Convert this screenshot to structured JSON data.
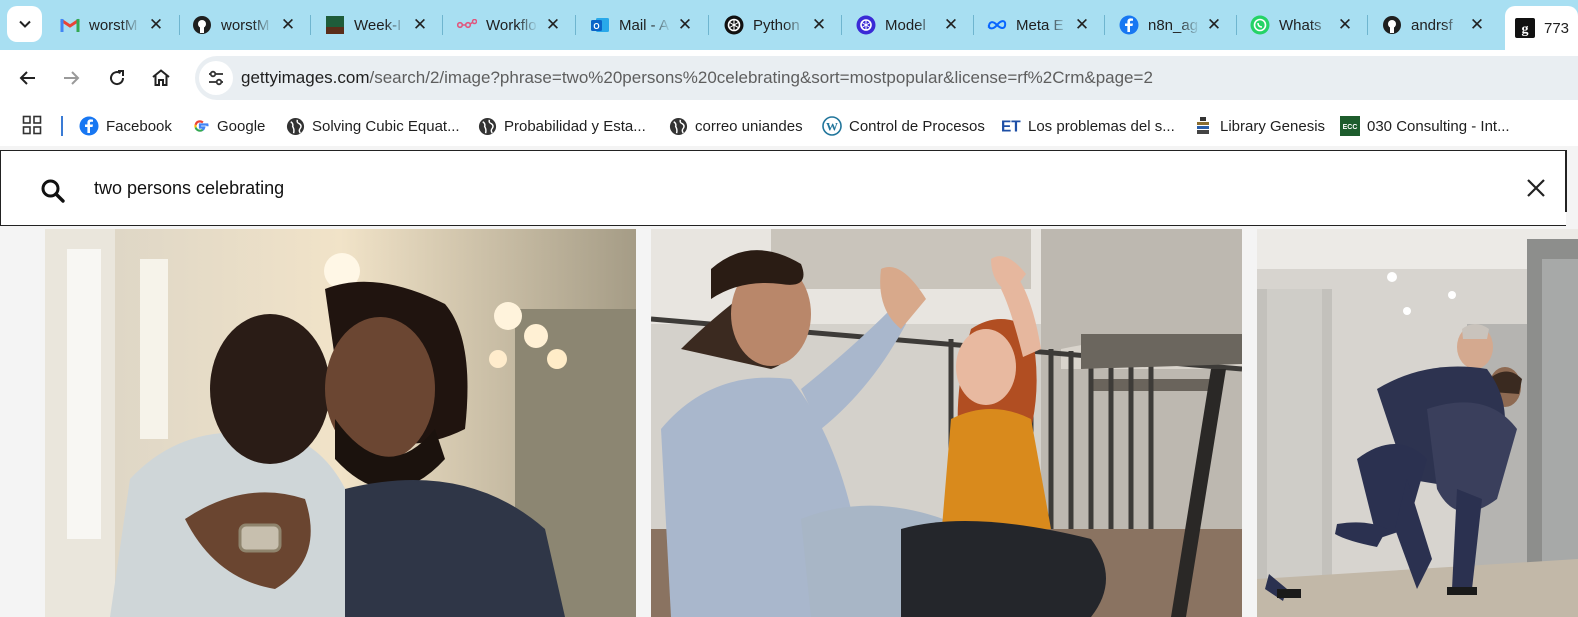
{
  "browser": {
    "tabs": [
      {
        "label": "worstM",
        "icon": "gmail-icon"
      },
      {
        "label": "worstM",
        "icon": "github-icon"
      },
      {
        "label": "Week-I",
        "icon": "sheet-icon"
      },
      {
        "label": "Workflo",
        "icon": "workflow-icon"
      },
      {
        "label": "Mail - A",
        "icon": "outlook-icon"
      },
      {
        "label": "Python",
        "icon": "openai-icon"
      },
      {
        "label": "Model",
        "icon": "model-icon"
      },
      {
        "label": "Meta E",
        "icon": "meta-icon"
      },
      {
        "label": "n8n_ag",
        "icon": "facebook-icon"
      },
      {
        "label": "Whats",
        "icon": "whatsapp-icon"
      },
      {
        "label": "andrsf",
        "icon": "github-icon"
      }
    ],
    "active_tab": {
      "label": "773",
      "icon": "gettyimages-icon"
    },
    "url_host": "gettyimages.com",
    "url_path": "/search/2/image?phrase=two%20persons%20celebrating&sort=mostpopular&license=rf%2Crm&page=2",
    "bookmarks": [
      {
        "label": "Facebook",
        "icon": "facebook-icon"
      },
      {
        "label": "Google",
        "icon": "google-icon"
      },
      {
        "label": "Solving Cubic Equat...",
        "icon": "globe-icon"
      },
      {
        "label": "Probabilidad y Esta...",
        "icon": "globe-icon"
      },
      {
        "label": "correo uniandes",
        "icon": "globe-icon"
      },
      {
        "label": "Control de Procesos",
        "icon": "wordpress-icon"
      },
      {
        "label": "Los problemas del s...",
        "icon": "et-icon"
      },
      {
        "label": "Library Genesis",
        "icon": "libgen-icon"
      },
      {
        "label": "030 Consulting - Int...",
        "icon": "ecc-icon"
      }
    ]
  },
  "search": {
    "query": "two persons celebrating"
  },
  "results": [
    {
      "subject": "two men hugging"
    },
    {
      "subject": "man and woman high five"
    },
    {
      "subject": "businessmen embracing"
    }
  ],
  "colors": {
    "tabstrip": "#a8dff2",
    "omnibox": "#e9eef2",
    "accent": "#3a7bd5"
  }
}
